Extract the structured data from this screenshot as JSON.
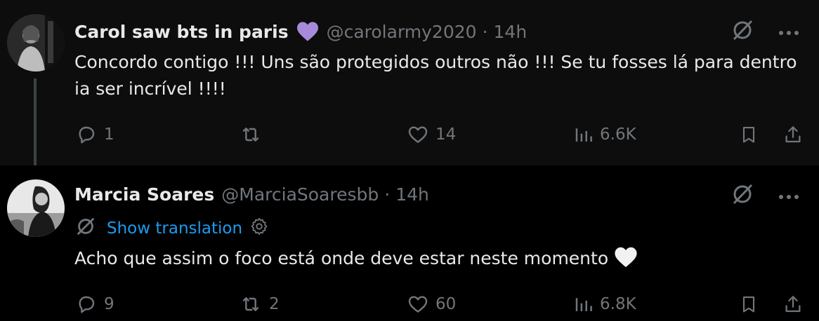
{
  "tweets": [
    {
      "author_name": "Carol saw bts in paris",
      "handle": "@carolarmy2020",
      "separator": "·",
      "time": "14h",
      "badge_icon": "purple-heart-icon",
      "text": "Concordo contigo !!! Uns são protegidos outros não !!! Se tu fosses lá para dentro ia ser incrível !!!!",
      "replies": "1",
      "retweets": "",
      "likes": "14",
      "views": "6.6K"
    },
    {
      "author_name": "Marcia Soares",
      "handle": "@MarciaSoaresbb",
      "separator": "·",
      "time": "14h",
      "translate_label": "Show translation",
      "text": "Acho que assim o foco está onde deve estar neste momento",
      "text_emoji": "white-heart-icon",
      "replies": "9",
      "retweets": "2",
      "likes": "60",
      "views": "6.8K"
    }
  ],
  "colors": {
    "background": "#000000",
    "parent_background": "#0d0d0d",
    "text": "#e7e9ea",
    "muted": "#71767b",
    "link": "#1d9bf0",
    "badge": "#a78bda"
  }
}
